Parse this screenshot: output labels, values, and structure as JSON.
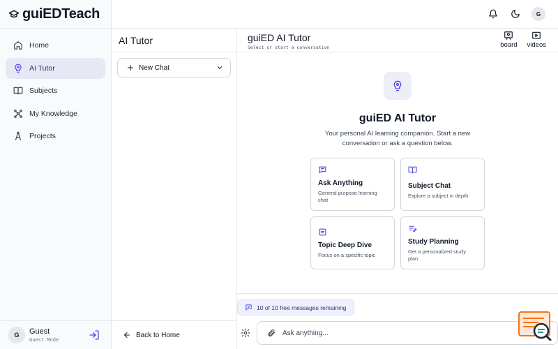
{
  "app": {
    "brand": "guiEDTeach"
  },
  "sidebar": {
    "items": [
      {
        "label": "Home",
        "icon": "home-icon"
      },
      {
        "label": "AI Tutor",
        "icon": "lightbulb-icon",
        "active": true
      },
      {
        "label": "Subjects",
        "icon": "book-icon"
      },
      {
        "label": "My Knowledge",
        "icon": "network-icon"
      },
      {
        "label": "Projects",
        "icon": "compass-icon"
      }
    ],
    "user": {
      "initial": "G",
      "name": "Guest",
      "mode": "Guest Mode"
    }
  },
  "topbar": {
    "avatar_initial": "G"
  },
  "chat_column": {
    "title": "AI Tutor",
    "new_chat_label": "New Chat",
    "back_label": "Back to Home"
  },
  "main": {
    "title": "guiED AI Tutor",
    "subtitle": "Select or start a conversation",
    "actions": [
      {
        "label": "board",
        "icon": "board-icon"
      },
      {
        "label": "videos",
        "icon": "video-icon"
      }
    ],
    "hero": {
      "title": "guiED AI Tutor",
      "description": "Your personal AI learning companion. Start a new conversation or ask a question below."
    },
    "cards": [
      {
        "title": "Ask Anything",
        "description": "General purpose learning chat",
        "icon": "chat-icon"
      },
      {
        "title": "Subject Chat",
        "description": "Explore a subject in depth",
        "icon": "book-open-icon"
      },
      {
        "title": "Topic Deep Dive",
        "description": "Focus on a specific topic",
        "icon": "document-icon"
      },
      {
        "title": "Study Planning",
        "description": "Get a personalized study plan",
        "icon": "plan-icon"
      }
    ],
    "quota": "10 of 10 free messages remaining",
    "input": {
      "placeholder": "Ask anything..."
    }
  },
  "colors": {
    "accent": "#4f46e5",
    "active_bg": "#e8e8f5",
    "border": "#e5e7eb"
  }
}
